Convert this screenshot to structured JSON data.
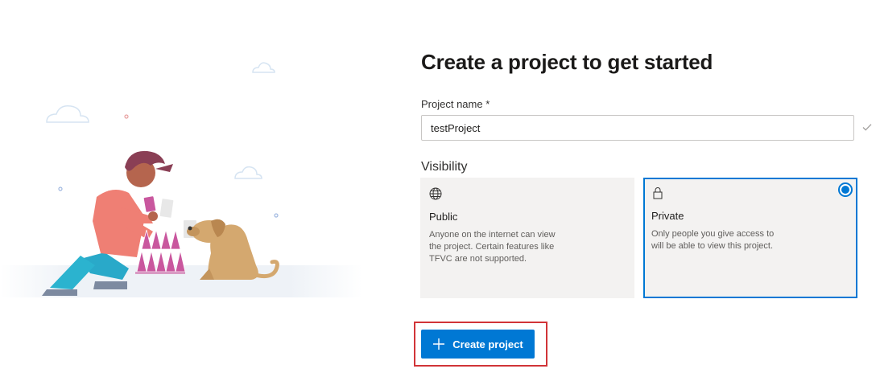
{
  "page": {
    "title": "Create a project to get started"
  },
  "project_name": {
    "label": "Project name *",
    "value": "testProject",
    "valid_icon": "check-icon"
  },
  "visibility": {
    "label": "Visibility",
    "options": [
      {
        "title": "Public",
        "description": "Anyone on the internet can view the project. Certain features like TFVC are not supported.",
        "icon": "globe-icon",
        "selected": false
      },
      {
        "title": "Private",
        "description": "Only people you give access to will be able to view this project.",
        "icon": "lock-icon",
        "selected": true
      }
    ]
  },
  "create_button": {
    "label": "Create project",
    "icon": "plus-icon"
  },
  "colors": {
    "accent": "#0078d4",
    "highlight": "#d13438"
  }
}
